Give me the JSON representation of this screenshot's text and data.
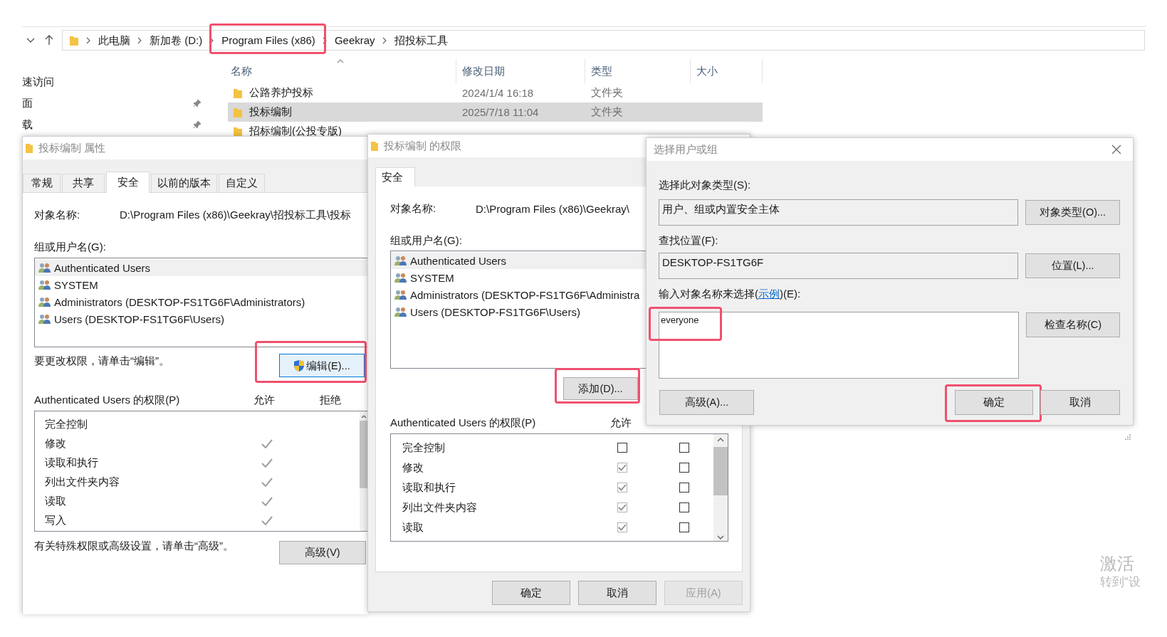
{
  "explorer": {
    "breadcrumb": [
      {
        "label": "此电脑",
        "highlighted": false
      },
      {
        "label": "新加卷 (D:)",
        "highlighted": false
      },
      {
        "label": "Program Files (x86)",
        "highlighted": true
      },
      {
        "label": "Geekray",
        "highlighted": false
      },
      {
        "label": "招投标工具",
        "highlighted": false
      }
    ],
    "nav_items": [
      {
        "label": "速访问",
        "pinned": false
      },
      {
        "label": "面",
        "pinned": true
      },
      {
        "label": "载",
        "pinned": true
      }
    ],
    "columns": [
      "名称",
      "修改日期",
      "类型",
      "大小"
    ],
    "rows": [
      {
        "name": "公路养护投标",
        "date": "2024/1/4 16:18",
        "type": "文件夹",
        "selected": false
      },
      {
        "name": "投标编制",
        "date": "2025/7/18 11:04",
        "type": "文件夹",
        "selected": true
      },
      {
        "name": "招标编制(公投专版)",
        "selected": false
      }
    ]
  },
  "properties_dialog": {
    "title": "投标编制 属性",
    "tabs": [
      {
        "label": "常规",
        "selected": false
      },
      {
        "label": "共享",
        "selected": false
      },
      {
        "label": "安全",
        "selected": true
      },
      {
        "label": "以前的版本",
        "selected": false
      },
      {
        "label": "自定义",
        "selected": false
      }
    ],
    "object_label": "对象名称:",
    "object_path": "D:\\Program Files (x86)\\Geekray\\招投标工具\\投标",
    "groups_label": "组或用户名(G):",
    "groups": [
      {
        "name": "Authenticated Users",
        "selected": true
      },
      {
        "name": "SYSTEM",
        "selected": false
      },
      {
        "name": "Administrators (DESKTOP-FS1TG6F\\Administrators)",
        "selected": false
      },
      {
        "name": "Users (DESKTOP-FS1TG6F\\Users)",
        "selected": false
      }
    ],
    "change_hint": "要更改权限，请单击“编辑”。",
    "edit_button": {
      "label": "编辑(E)...",
      "highlighted": true
    },
    "permissions_label": "Authenticated Users 的权限(P)",
    "allow_label": "允许",
    "deny_label": "拒绝",
    "permissions": [
      {
        "name": "完全控制",
        "allow": false,
        "deny": false
      },
      {
        "name": "修改",
        "allow": true,
        "deny": false
      },
      {
        "name": "读取和执行",
        "allow": true,
        "deny": false
      },
      {
        "name": "列出文件夹内容",
        "allow": true,
        "deny": false
      },
      {
        "name": "读取",
        "allow": true,
        "deny": false
      },
      {
        "name": "写入",
        "allow": true,
        "deny": false
      }
    ],
    "advanced_hint": "有关特殊权限或高级设置，请单击“高级”。",
    "advanced_button": "高级(V)"
  },
  "permissions_dialog": {
    "title": "投标编制 的权限",
    "tabs": [
      {
        "label": "安全",
        "selected": true
      }
    ],
    "object_label": "对象名称:",
    "object_path": "D:\\Program Files (x86)\\Geekray\\",
    "groups_label": "组或用户名(G):",
    "groups": [
      {
        "name": "Authenticated Users",
        "selected": true
      },
      {
        "name": "SYSTEM",
        "selected": false
      },
      {
        "name": "Administrators (DESKTOP-FS1TG6F\\Administra",
        "selected": false
      },
      {
        "name": "Users (DESKTOP-FS1TG6F\\Users)",
        "selected": false
      }
    ],
    "add_button": {
      "label": "添加(D)...",
      "highlighted": true
    },
    "permissions_label": "Authenticated Users 的权限(P)",
    "allow_label": "允许",
    "permissions": [
      {
        "name": "完全控制",
        "allow": false,
        "allow_disabled": false,
        "deny": false
      },
      {
        "name": "修改",
        "allow": true,
        "allow_disabled": true,
        "deny": false
      },
      {
        "name": "读取和执行",
        "allow": true,
        "allow_disabled": true,
        "deny": false
      },
      {
        "name": "列出文件夹内容",
        "allow": true,
        "allow_disabled": true,
        "deny": false
      },
      {
        "name": "读取",
        "allow": true,
        "allow_disabled": true,
        "deny": false
      }
    ],
    "buttons": [
      {
        "label": "确定",
        "disabled": false
      },
      {
        "label": "取消",
        "disabled": false
      },
      {
        "label": "应用(A)",
        "disabled": true
      }
    ]
  },
  "select_dialog": {
    "title": "选择用户或组",
    "object_types_label": "选择此对象类型(S):",
    "object_types_value": "用户、组或内置安全主体",
    "object_types_button": "对象类型(O)...",
    "location_label": "查找位置(F):",
    "location_value": "DESKTOP-FS1TG6F",
    "location_button": "位置(L)...",
    "names_label_before": "输入对象名称来选择(",
    "example_link": "示例",
    "names_label_after": ")(E):",
    "names_field": {
      "value": "everyone",
      "highlighted": true
    },
    "check_button": "检查名称(C)",
    "advanced_button": "高级(A)...",
    "buttons": [
      {
        "label": "确定",
        "highlighted": true
      },
      {
        "label": "取消",
        "highlighted": false
      }
    ]
  },
  "activation_notice": {
    "title": "激活",
    "subtitle": "转到“设"
  }
}
